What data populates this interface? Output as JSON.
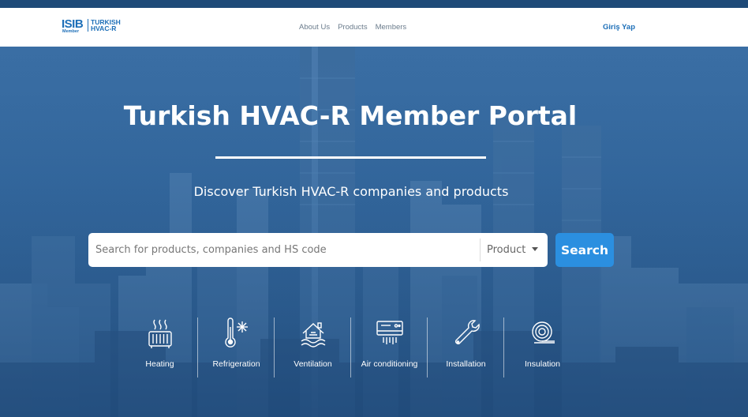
{
  "nav": {
    "logo": {
      "brand": "ISIB",
      "sub": "Member",
      "line1": "TURKISH",
      "line2": "HVAC-R"
    },
    "links": [
      "About Us",
      "Products",
      "Members"
    ],
    "login": "Giriş Yap"
  },
  "hero": {
    "title": "Turkish HVAC-R Member Portal",
    "subtitle": "Discover Turkish HVAC-R companies and products"
  },
  "search": {
    "placeholder": "Search for products, companies and HS code",
    "value": "",
    "select_value": "Product",
    "button_label": "Search"
  },
  "categories": [
    {
      "label": "Heating",
      "icon": "radiator-icon"
    },
    {
      "label": "Refrigeration",
      "icon": "thermometer-snowflake-icon"
    },
    {
      "label": "Ventilation",
      "icon": "house-airflow-icon"
    },
    {
      "label": "Air conditioning",
      "icon": "air-conditioner-icon"
    },
    {
      "label": "Installation",
      "icon": "wrench-icon"
    },
    {
      "label": "Insulation",
      "icon": "insulation-roll-icon"
    }
  ],
  "colors": {
    "accent": "#1d6fb8",
    "button": "#2b8fe0",
    "hero_bg": "#2f6399",
    "top_strip": "#1e4a78"
  }
}
